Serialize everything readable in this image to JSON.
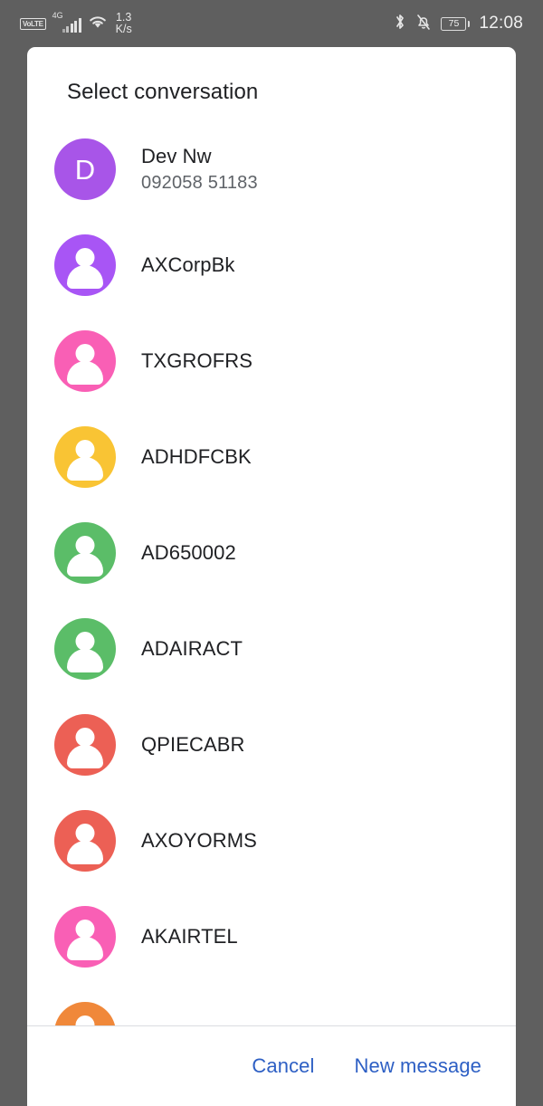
{
  "status_bar": {
    "volte_label": "VoLTE",
    "network_label": "4G",
    "signal_icon": "signal-bars-icon",
    "wifi_icon": "wifi-icon",
    "data_rate_value": "1.3",
    "data_rate_unit": "K/s",
    "bluetooth_icon": "bluetooth-icon",
    "silent_icon": "bell-off-icon",
    "battery_percent": "75",
    "time": "12:08"
  },
  "dialog": {
    "title": "Select conversation",
    "conversations": [
      {
        "name": "Dev Nw",
        "subtitle": "092058 51183",
        "initial": "D",
        "avatar_type": "letter",
        "color": "#a855e8"
      },
      {
        "name": "AXCorpBk",
        "subtitle": "",
        "initial": "",
        "avatar_type": "person",
        "color": "#a855f5"
      },
      {
        "name": "TXGROFRS",
        "subtitle": "",
        "initial": "",
        "avatar_type": "person",
        "color": "#f95fb5"
      },
      {
        "name": "ADHDFCBK",
        "subtitle": "",
        "initial": "",
        "avatar_type": "person",
        "color": "#f9c434"
      },
      {
        "name": "AD650002",
        "subtitle": "",
        "initial": "",
        "avatar_type": "person",
        "color": "#5bbd68"
      },
      {
        "name": "ADAIRACT",
        "subtitle": "",
        "initial": "",
        "avatar_type": "person",
        "color": "#5bbd68"
      },
      {
        "name": "QPIECABR",
        "subtitle": "",
        "initial": "",
        "avatar_type": "person",
        "color": "#ec6055"
      },
      {
        "name": "AXOYORMS",
        "subtitle": "",
        "initial": "",
        "avatar_type": "person",
        "color": "#ec6055"
      },
      {
        "name": "AKAIRTEL",
        "subtitle": "",
        "initial": "",
        "avatar_type": "person",
        "color": "#f95fb5"
      },
      {
        "name": "",
        "subtitle": "",
        "initial": "",
        "avatar_type": "person",
        "color": "#f0883a"
      }
    ],
    "cancel_label": "Cancel",
    "new_message_label": "New message",
    "accent_color": "#2d5fc4"
  }
}
